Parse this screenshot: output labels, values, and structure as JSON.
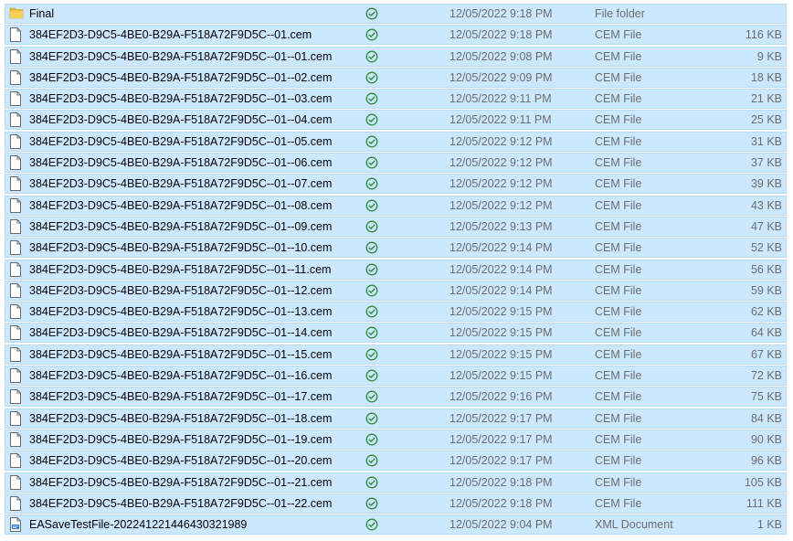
{
  "files": [
    {
      "name": "Final",
      "date": "12/05/2022 9:18 PM",
      "type": "File folder",
      "size": "",
      "icon": "folder-icon"
    },
    {
      "name": "384EF2D3-D9C5-4BE0-B29A-F518A72F9D5C--01.cem",
      "date": "12/05/2022 9:18 PM",
      "type": "CEM File",
      "size": "116 KB",
      "icon": "file-icon"
    },
    {
      "name": "384EF2D3-D9C5-4BE0-B29A-F518A72F9D5C--01--01.cem",
      "date": "12/05/2022 9:08 PM",
      "type": "CEM File",
      "size": "9 KB",
      "icon": "file-icon"
    },
    {
      "name": "384EF2D3-D9C5-4BE0-B29A-F518A72F9D5C--01--02.cem",
      "date": "12/05/2022 9:09 PM",
      "type": "CEM File",
      "size": "18 KB",
      "icon": "file-icon"
    },
    {
      "name": "384EF2D3-D9C5-4BE0-B29A-F518A72F9D5C--01--03.cem",
      "date": "12/05/2022 9:11 PM",
      "type": "CEM File",
      "size": "21 KB",
      "icon": "file-icon"
    },
    {
      "name": "384EF2D3-D9C5-4BE0-B29A-F518A72F9D5C--01--04.cem",
      "date": "12/05/2022 9:11 PM",
      "type": "CEM File",
      "size": "25 KB",
      "icon": "file-icon"
    },
    {
      "name": "384EF2D3-D9C5-4BE0-B29A-F518A72F9D5C--01--05.cem",
      "date": "12/05/2022 9:12 PM",
      "type": "CEM File",
      "size": "31 KB",
      "icon": "file-icon"
    },
    {
      "name": "384EF2D3-D9C5-4BE0-B29A-F518A72F9D5C--01--06.cem",
      "date": "12/05/2022 9:12 PM",
      "type": "CEM File",
      "size": "37 KB",
      "icon": "file-icon"
    },
    {
      "name": "384EF2D3-D9C5-4BE0-B29A-F518A72F9D5C--01--07.cem",
      "date": "12/05/2022 9:12 PM",
      "type": "CEM File",
      "size": "39 KB",
      "icon": "file-icon"
    },
    {
      "name": "384EF2D3-D9C5-4BE0-B29A-F518A72F9D5C--01--08.cem",
      "date": "12/05/2022 9:12 PM",
      "type": "CEM File",
      "size": "43 KB",
      "icon": "file-icon"
    },
    {
      "name": "384EF2D3-D9C5-4BE0-B29A-F518A72F9D5C--01--09.cem",
      "date": "12/05/2022 9:13 PM",
      "type": "CEM File",
      "size": "47 KB",
      "icon": "file-icon"
    },
    {
      "name": "384EF2D3-D9C5-4BE0-B29A-F518A72F9D5C--01--10.cem",
      "date": "12/05/2022 9:14 PM",
      "type": "CEM File",
      "size": "52 KB",
      "icon": "file-icon"
    },
    {
      "name": "384EF2D3-D9C5-4BE0-B29A-F518A72F9D5C--01--11.cem",
      "date": "12/05/2022 9:14 PM",
      "type": "CEM File",
      "size": "56 KB",
      "icon": "file-icon"
    },
    {
      "name": "384EF2D3-D9C5-4BE0-B29A-F518A72F9D5C--01--12.cem",
      "date": "12/05/2022 9:14 PM",
      "type": "CEM File",
      "size": "59 KB",
      "icon": "file-icon"
    },
    {
      "name": "384EF2D3-D9C5-4BE0-B29A-F518A72F9D5C--01--13.cem",
      "date": "12/05/2022 9:15 PM",
      "type": "CEM File",
      "size": "62 KB",
      "icon": "file-icon"
    },
    {
      "name": "384EF2D3-D9C5-4BE0-B29A-F518A72F9D5C--01--14.cem",
      "date": "12/05/2022 9:15 PM",
      "type": "CEM File",
      "size": "64 KB",
      "icon": "file-icon"
    },
    {
      "name": "384EF2D3-D9C5-4BE0-B29A-F518A72F9D5C--01--15.cem",
      "date": "12/05/2022 9:15 PM",
      "type": "CEM File",
      "size": "67 KB",
      "icon": "file-icon"
    },
    {
      "name": "384EF2D3-D9C5-4BE0-B29A-F518A72F9D5C--01--16.cem",
      "date": "12/05/2022 9:15 PM",
      "type": "CEM File",
      "size": "72 KB",
      "icon": "file-icon"
    },
    {
      "name": "384EF2D3-D9C5-4BE0-B29A-F518A72F9D5C--01--17.cem",
      "date": "12/05/2022 9:16 PM",
      "type": "CEM File",
      "size": "75 KB",
      "icon": "file-icon"
    },
    {
      "name": "384EF2D3-D9C5-4BE0-B29A-F518A72F9D5C--01--18.cem",
      "date": "12/05/2022 9:17 PM",
      "type": "CEM File",
      "size": "84 KB",
      "icon": "file-icon"
    },
    {
      "name": "384EF2D3-D9C5-4BE0-B29A-F518A72F9D5C--01--19.cem",
      "date": "12/05/2022 9:17 PM",
      "type": "CEM File",
      "size": "90 KB",
      "icon": "file-icon"
    },
    {
      "name": "384EF2D3-D9C5-4BE0-B29A-F518A72F9D5C--01--20.cem",
      "date": "12/05/2022 9:17 PM",
      "type": "CEM File",
      "size": "96 KB",
      "icon": "file-icon"
    },
    {
      "name": "384EF2D3-D9C5-4BE0-B29A-F518A72F9D5C--01--21.cem",
      "date": "12/05/2022 9:18 PM",
      "type": "CEM File",
      "size": "105 KB",
      "icon": "file-icon"
    },
    {
      "name": "384EF2D3-D9C5-4BE0-B29A-F518A72F9D5C--01--22.cem",
      "date": "12/05/2022 9:18 PM",
      "type": "CEM File",
      "size": "111 KB",
      "icon": "file-icon"
    },
    {
      "name": "EASaveTestFile-20224122144643 0321989",
      "date": "12/05/2022 9:04 PM",
      "type": "XML Document",
      "size": "1 KB",
      "icon": "xml-document-icon"
    }
  ],
  "colors": {
    "selection_bg": "#cce8ff",
    "selection_border": "#b8d9f5",
    "status_green": "#2e8b3a",
    "folder_yellow": "#e8b83a"
  }
}
